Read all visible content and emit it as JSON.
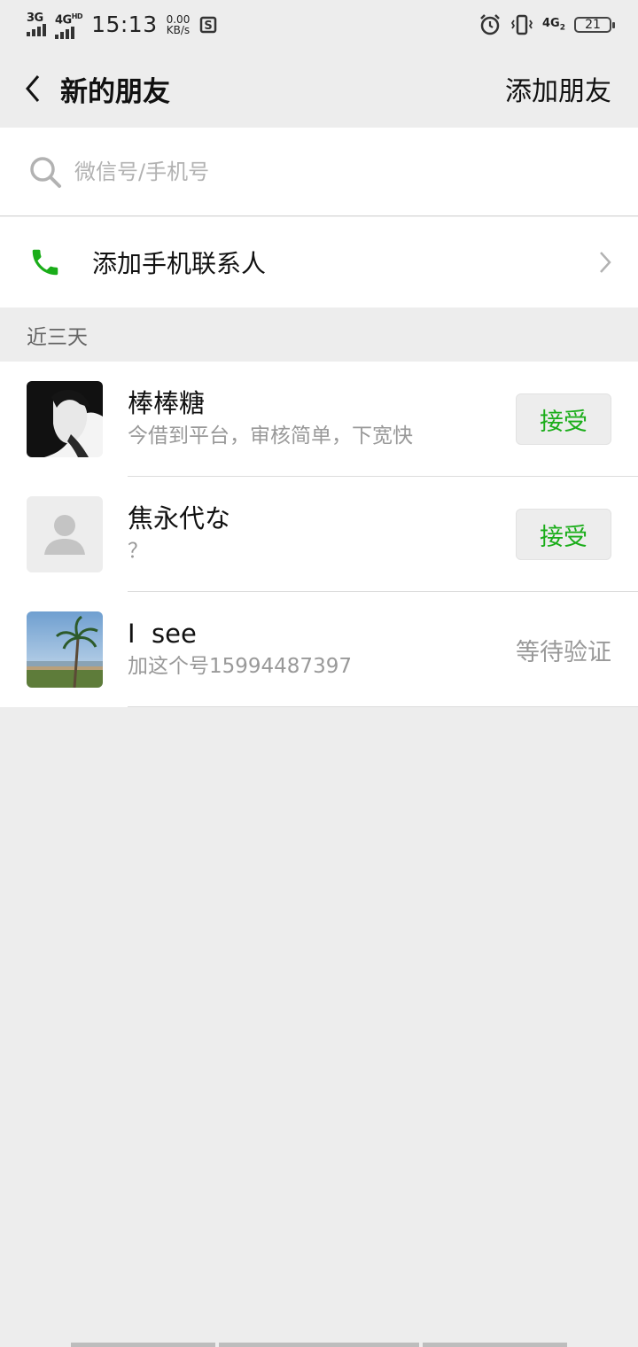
{
  "status_bar": {
    "signal1": "3G",
    "signal2": "4G",
    "signal2_sup": "HD",
    "time": "15:13",
    "speed_value": "0.00",
    "speed_unit": "KB/s",
    "lte": "4G",
    "lte_sub": "2",
    "battery": "21"
  },
  "nav": {
    "title": "新的朋友",
    "action": "添加朋友"
  },
  "search": {
    "placeholder": "微信号/手机号"
  },
  "phone_contacts": {
    "label": "添加手机联系人"
  },
  "section": {
    "title": "近三天"
  },
  "requests": [
    {
      "name": "棒棒糖",
      "message": "今借到平台，审核简单，下宽快",
      "action": "接受"
    },
    {
      "name": "焦永代な",
      "message": "？",
      "action": "接受"
    },
    {
      "name": "I  see",
      "message": "加这个号15994487397",
      "status": "等待验证"
    }
  ],
  "colors": {
    "accent_green": "#1aad19",
    "background": "#ededed"
  }
}
